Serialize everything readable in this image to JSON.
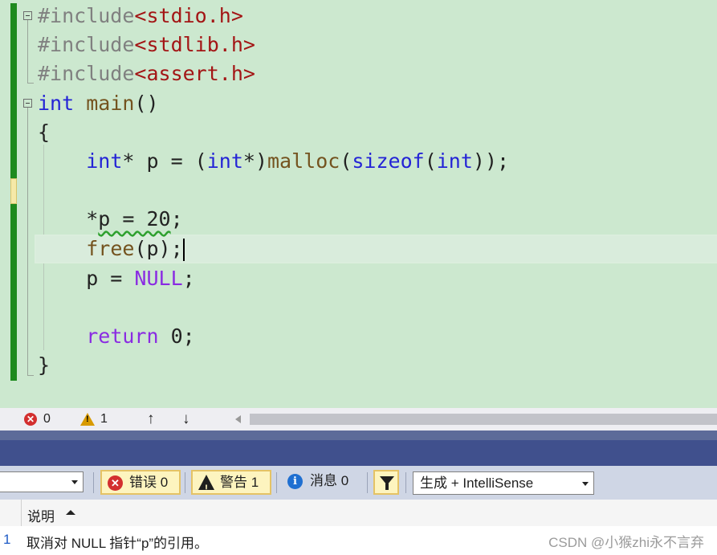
{
  "editor": {
    "lines": [
      {
        "parts": [
          {
            "t": "#include",
            "c": "pp"
          },
          {
            "t": "<stdio.h>",
            "c": "str"
          }
        ]
      },
      {
        "parts": [
          {
            "t": "#include",
            "c": "pp"
          },
          {
            "t": "<stdlib.h>",
            "c": "str"
          }
        ]
      },
      {
        "parts": [
          {
            "t": "#include",
            "c": "pp"
          },
          {
            "t": "<assert.h>",
            "c": "str"
          }
        ]
      },
      {
        "parts": [
          {
            "t": "int",
            "c": "kw"
          },
          {
            "t": " "
          },
          {
            "t": "main",
            "c": "fn"
          },
          {
            "t": "()"
          }
        ]
      },
      {
        "parts": [
          {
            "t": "{"
          }
        ]
      },
      {
        "parts": [
          {
            "t": "    "
          },
          {
            "t": "int",
            "c": "kw"
          },
          {
            "t": "* p = ("
          },
          {
            "t": "int",
            "c": "kw"
          },
          {
            "t": "*)"
          },
          {
            "t": "malloc",
            "c": "fn"
          },
          {
            "t": "("
          },
          {
            "t": "sizeof",
            "c": "kw"
          },
          {
            "t": "("
          },
          {
            "t": "int",
            "c": "kw"
          },
          {
            "t": "));"
          }
        ]
      },
      {
        "parts": [
          {
            "t": ""
          }
        ]
      },
      {
        "parts": [
          {
            "t": "    *"
          },
          {
            "t": "p = 20",
            "c": "sq"
          },
          {
            "t": ";"
          }
        ]
      },
      {
        "parts": [
          {
            "t": "    "
          },
          {
            "t": "free",
            "c": "fn"
          },
          {
            "t": "(p);"
          }
        ],
        "caret": true
      },
      {
        "parts": [
          {
            "t": "    p = "
          },
          {
            "t": "NULL",
            "c": "kw2"
          },
          {
            "t": ";"
          }
        ]
      },
      {
        "parts": [
          {
            "t": ""
          }
        ]
      },
      {
        "parts": [
          {
            "t": "    "
          },
          {
            "t": "return",
            "c": "kw2"
          },
          {
            "t": " 0;"
          }
        ]
      },
      {
        "parts": [
          {
            "t": "}"
          }
        ]
      }
    ]
  },
  "status": {
    "errors": "0",
    "warnings": "1",
    "error_icon": "x-circle-icon",
    "warning_icon": "warning-triangle-icon",
    "up_arrow": "↑",
    "down_arrow": "↓"
  },
  "toolbar": {
    "errors_label": "错误 0",
    "warnings_label": "警告 1",
    "messages_label": "消息 0",
    "source_value": "生成 + IntelliSense"
  },
  "list": {
    "col_header": "说明",
    "row_number": "1",
    "row_text": "取消对 NULL 指针“p”的引用。",
    "watermark": "CSDN @小猴zhi永不言弃"
  },
  "colors": {
    "editor_bg": "#cce8cf",
    "keyword": "#2424d6",
    "control_keyword": "#8a2be2",
    "string": "#a31515",
    "function": "#74531f",
    "change_bar": "#1e8a1e"
  }
}
